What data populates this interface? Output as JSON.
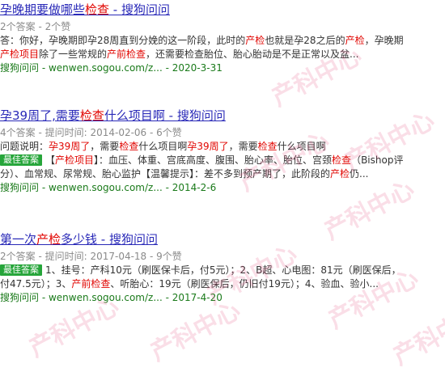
{
  "results": [
    {
      "title_pre": "孕晚期要做哪些",
      "title_hl": "检查",
      "title_post": " - 搜狗问问",
      "meta": "2个答案 - 2个赞",
      "snippet1": [
        {
          "t": "答：你好，孕晚期即孕28周直到分娩的这一阶段，此时的"
        },
        {
          "t": "产检",
          "hl": true
        },
        {
          "t": "也就是孕28之后的"
        },
        {
          "t": "产检",
          "hl": true
        },
        {
          "t": "，孕晚期"
        }
      ],
      "snippet2": [
        {
          "t": "产检项目",
          "hl": true
        },
        {
          "t": "除了一些常规的"
        },
        {
          "t": "产前检查",
          "hl": true
        },
        {
          "t": "，还需要检查胎位、胎心胎动是不是正常以及盆..."
        }
      ],
      "source_site": "搜狗问问",
      "source_url": " - wenwen.sogou.com/z... - 2020-3-31"
    },
    {
      "title_pre": "孕39周了,需要",
      "title_hl": "检查",
      "title_post": "什么项目啊 - 搜狗问问",
      "meta": "4个答案 - 提问时间: 2014-02-06 - 6个赞",
      "question_label": "问题说明：",
      "question": [
        {
          "t": "孕39周了",
          "hl": true
        },
        {
          "t": "，需要"
        },
        {
          "t": "检查",
          "hl": true
        },
        {
          "t": "什么项目啊"
        },
        {
          "t": "孕39周了",
          "hl": true
        },
        {
          "t": "，需要"
        },
        {
          "t": "检查",
          "hl": true
        },
        {
          "t": "什么项目啊"
        }
      ],
      "badge": "最佳答案",
      "snippet1": [
        {
          "t": "【"
        },
        {
          "t": "产检项目",
          "hl": true
        },
        {
          "t": "】：血压、体重、宫底高度、腹围、胎心率、胎位、宫颈"
        },
        {
          "t": "检查",
          "hl": true
        },
        {
          "t": "（Bishop评"
        }
      ],
      "snippet2": [
        {
          "t": "分）、血常规、尿常规、胎心监护【温馨提示】：差不多到预产期了，此阶段的"
        },
        {
          "t": "产检",
          "hl": true
        },
        {
          "t": "仍..."
        }
      ],
      "source_site": "搜狗问问",
      "source_url": " - wenwen.sogou.com/z... - 2014-2-6"
    },
    {
      "title_pre": "第一次",
      "title_hl": "产检",
      "title_post": "多少钱 - 搜狗问问",
      "meta": "2个答案 - 提问时间: 2017-04-18 - 9个赞",
      "badge": "最佳答案",
      "snippet1": [
        {
          "t": "1、挂号：产科10元（刷医保卡后，付5元）；2、B超、心电图：81元（刷医保后，"
        }
      ],
      "snippet2": [
        {
          "t": "付47.5元）；3、"
        },
        {
          "t": "产前检查",
          "hl": true
        },
        {
          "t": "、听胎心：19元（刷医保后，仍旧付19元）；4、验血、验小..."
        }
      ],
      "source_site": "搜狗问问",
      "source_url": " - wenwen.sogou.com/z... - 2017-4-20"
    }
  ],
  "watermark": "产科中心"
}
